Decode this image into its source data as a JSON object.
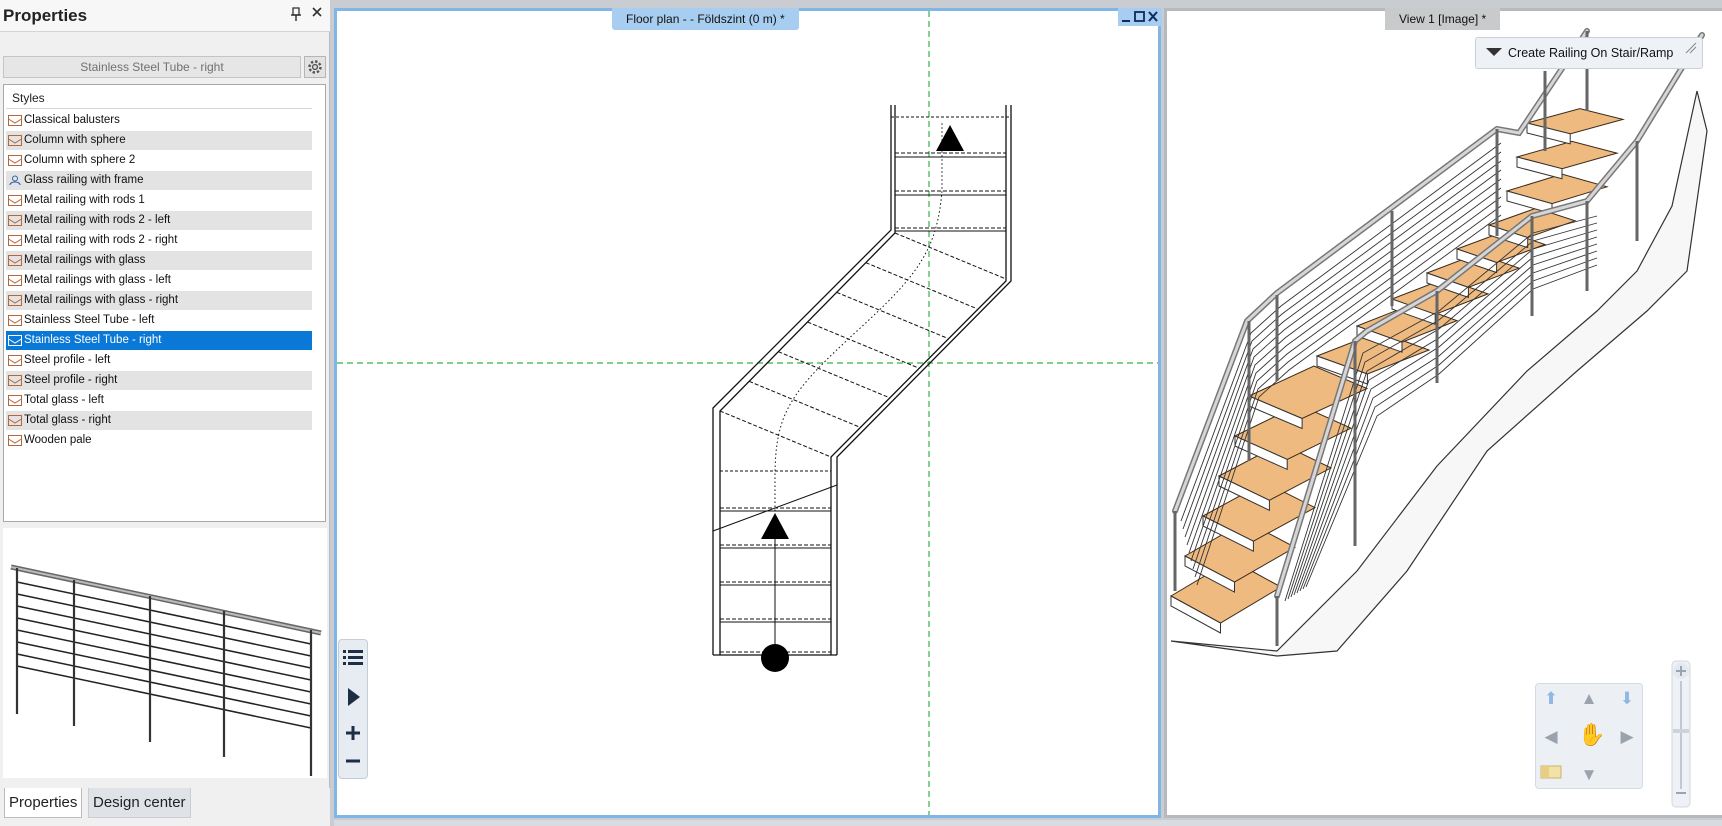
{
  "panel": {
    "title": "Properties",
    "selected_style": "Stainless Steel Tube - right",
    "styles_header": "Styles",
    "styles": [
      "Classical balusters",
      "Column with sphere",
      "Column with sphere 2",
      "Glass railing with frame",
      "Metal railing with rods 1",
      "Metal railing with rods 2 - left",
      "Metal railing with rods 2 - right",
      "Metal railings with glass",
      "Metal railings with glass - left",
      "Metal railings with glass - right",
      "Stainless Steel Tube - left",
      "Stainless Steel Tube - right",
      "Steel profile - left",
      "Steel profile - right",
      "Total glass - left",
      "Total glass - right",
      "Wooden pale"
    ],
    "selected_index": 11,
    "tabs": [
      "Properties",
      "Design center"
    ],
    "active_tab": "Properties"
  },
  "floor_plan": {
    "tab_title": "Floor plan -  - Földszint (0 m) *"
  },
  "view3d": {
    "tab_title": "View 1 [Image] *",
    "create_railing_label": "Create Railing On Stair/Ramp"
  },
  "colors": {
    "accent": "#0a78d7",
    "guide_lines": "#35b04a",
    "tread": "#efba80",
    "view_border_active": "#7fb6e6"
  },
  "icons": {
    "pin": "pin-icon",
    "close": "close-icon",
    "gear": "gear-icon",
    "list": "list-icon",
    "play": "play-icon",
    "zoom_in": "plus-icon",
    "zoom_out": "minus-icon",
    "pan": "hand-icon"
  }
}
